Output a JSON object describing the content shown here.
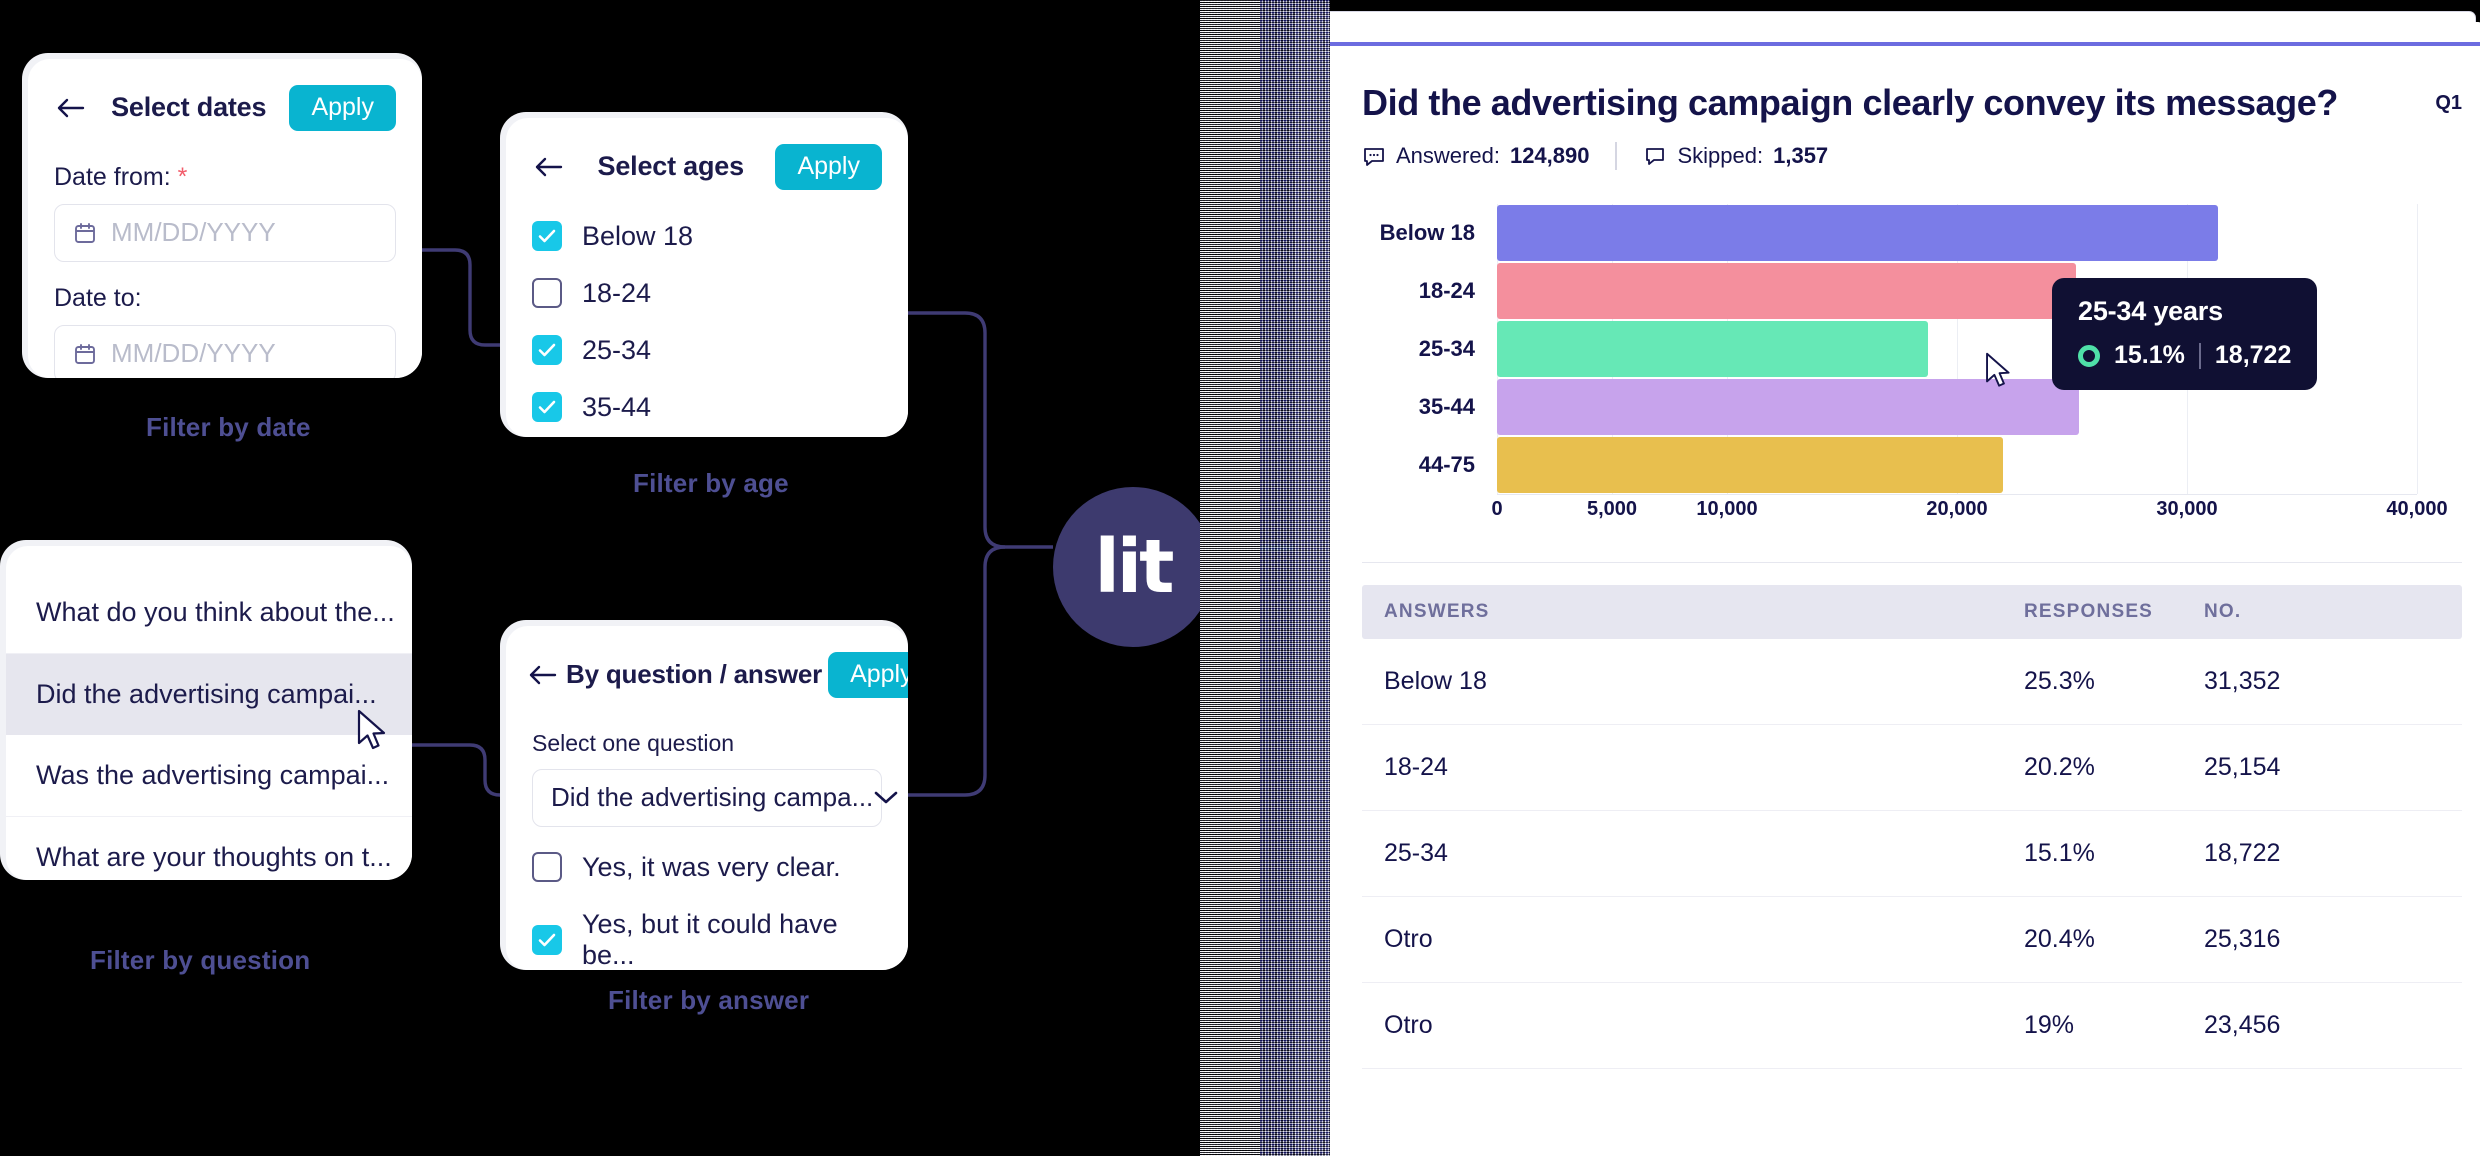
{
  "filters": {
    "date": {
      "title": "Select dates",
      "apply_label": "Apply",
      "back_icon": "back-arrow-icon",
      "from_label": "Date from:",
      "from_required": "*",
      "from_placeholder": "MM/DD/YYYY",
      "to_label": "Date to:",
      "to_placeholder": "MM/DD/YYYY",
      "caption": "Filter by date"
    },
    "age": {
      "title": "Select ages",
      "apply_label": "Apply",
      "caption": "Filter by age",
      "options": [
        {
          "label": "Below 18",
          "checked": true
        },
        {
          "label": "18-24",
          "checked": false
        },
        {
          "label": "25-34",
          "checked": true
        },
        {
          "label": "35-44",
          "checked": true
        }
      ]
    },
    "question": {
      "caption": "Filter by question",
      "items": [
        {
          "label": "What do you think about the...",
          "selected": false
        },
        {
          "label": "Did the advertising campai...",
          "selected": true
        },
        {
          "label": "Was the advertising campai...",
          "selected": false
        },
        {
          "label": "What are your thoughts on t...",
          "selected": false
        }
      ]
    },
    "answer": {
      "title": "By question / answer",
      "apply_label": "Apply",
      "caption": "Filter by answer",
      "select_label": "Select one question",
      "selected_question": "Did the advertising campa...",
      "chevron_icon": "chevron-down-icon",
      "options": [
        {
          "label": "Yes, it was very clear.",
          "checked": false
        },
        {
          "label": "Yes, but it could have be...",
          "checked": true
        }
      ]
    }
  },
  "brand": {
    "logo_text": "lit",
    "logo_bg": "#3d3a6e",
    "accent": "#19b8d6"
  },
  "dashboard": {
    "question": "Did the advertising campaign clearly convey its message?",
    "question_number": "Q1",
    "answered_label": "Answered:",
    "answered_value": "124,890",
    "skipped_label": "Skipped:",
    "skipped_value": "1,357",
    "answered_icon": "comment-dots-icon",
    "skipped_icon": "comment-icon",
    "tooltip": {
      "title": "25-34 years",
      "percent": "15.1%",
      "count": "18,722",
      "dot_color": "#4fe0a8"
    },
    "table": {
      "columns": [
        "ANSWERS",
        "RESPONSES",
        "NO."
      ],
      "rows": [
        {
          "answer": "Below 18",
          "responses": "25.3%",
          "no": "31,352"
        },
        {
          "answer": "18-24",
          "responses": "20.2%",
          "no": "25,154"
        },
        {
          "answer": "25-34",
          "responses": "15.1%",
          "no": "18,722"
        },
        {
          "answer": "Otro",
          "responses": "20.4%",
          "no": "25,316"
        },
        {
          "answer": "Otro",
          "responses": "19%",
          "no": "23,456"
        }
      ]
    }
  },
  "chart_data": {
    "type": "bar",
    "orientation": "horizontal",
    "title": "Did the advertising campaign clearly convey its message?",
    "xlabel": "",
    "ylabel": "",
    "categories": [
      "Below 18",
      "18-24",
      "25-34",
      "35-44",
      "44-75"
    ],
    "values": [
      31352,
      25154,
      18722,
      25316,
      22000
    ],
    "colors": [
      "#7b7ce8",
      "#f48f9d",
      "#66e8b6",
      "#c7a3ec",
      "#e8bf4e"
    ],
    "xlim": [
      0,
      40000
    ],
    "xticks": [
      0,
      5000,
      10000,
      15000,
      20000,
      25000,
      30000,
      35000,
      40000
    ],
    "xticklabels_shown": [
      "0",
      "5,000",
      "10,000",
      "20,000",
      "30,000",
      "40,000"
    ],
    "xticklabel_values": [
      0,
      5000,
      10000,
      20000,
      30000,
      40000
    ],
    "grid": true,
    "legend": false
  }
}
